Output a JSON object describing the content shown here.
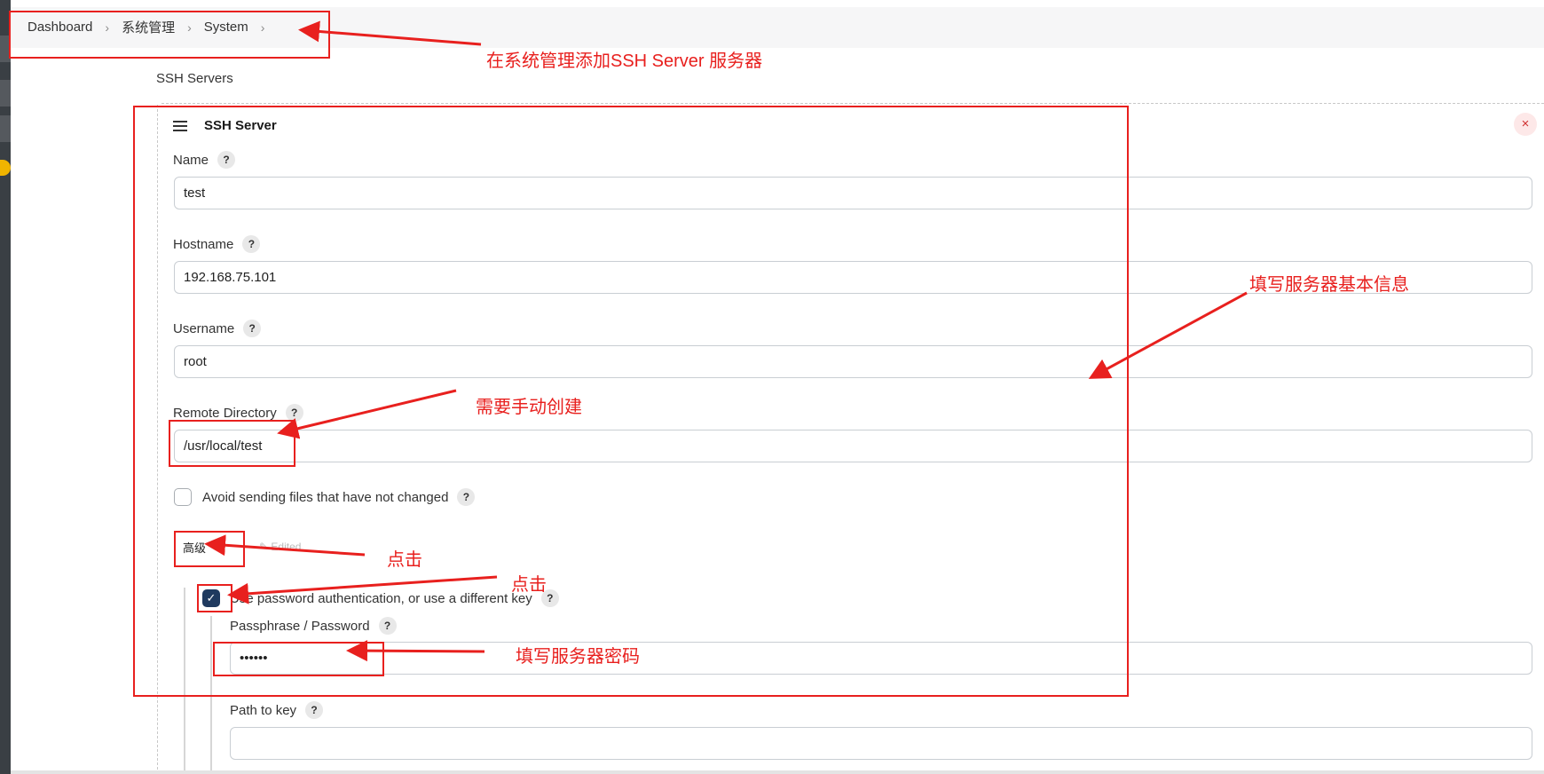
{
  "breadcrumb": {
    "items": [
      "Dashboard",
      "系统管理",
      "System"
    ],
    "separator": ">"
  },
  "section_title": "SSH Servers",
  "server": {
    "title": "SSH Server",
    "delete_icon": "×",
    "help_icon": "?",
    "fields": {
      "name": {
        "label": "Name",
        "value": "test"
      },
      "hostname": {
        "label": "Hostname",
        "value": "192.168.75.101"
      },
      "username": {
        "label": "Username",
        "value": "root"
      },
      "remote_directory": {
        "label": "Remote Directory",
        "value": "/usr/local/test"
      }
    },
    "avoid_sending": {
      "label": "Avoid sending files that have not changed",
      "checked": false
    },
    "advanced": {
      "label": "高级",
      "edited_label": "Edited"
    },
    "use_password": {
      "label": "Use password authentication, or use a different key",
      "checked": true,
      "check_glyph": "✓"
    },
    "passphrase": {
      "label": "Passphrase / Password",
      "value": "••••••"
    },
    "path_to_key": {
      "label": "Path to key",
      "value": ""
    }
  },
  "annotations": {
    "add_ssh_server": "在系统管理添加SSH Server 服务器",
    "fill_basic_info": "填写服务器基本信息",
    "manual_create": "需要手动创建",
    "click_1": "点击",
    "click_2": "点击",
    "fill_password": "填写服务器密码",
    "color": "#e8201e"
  },
  "colors": {
    "accent_checkbox": "#1f3a5f",
    "delete_bg": "#fde8e8",
    "delete_fg": "#d03030"
  }
}
